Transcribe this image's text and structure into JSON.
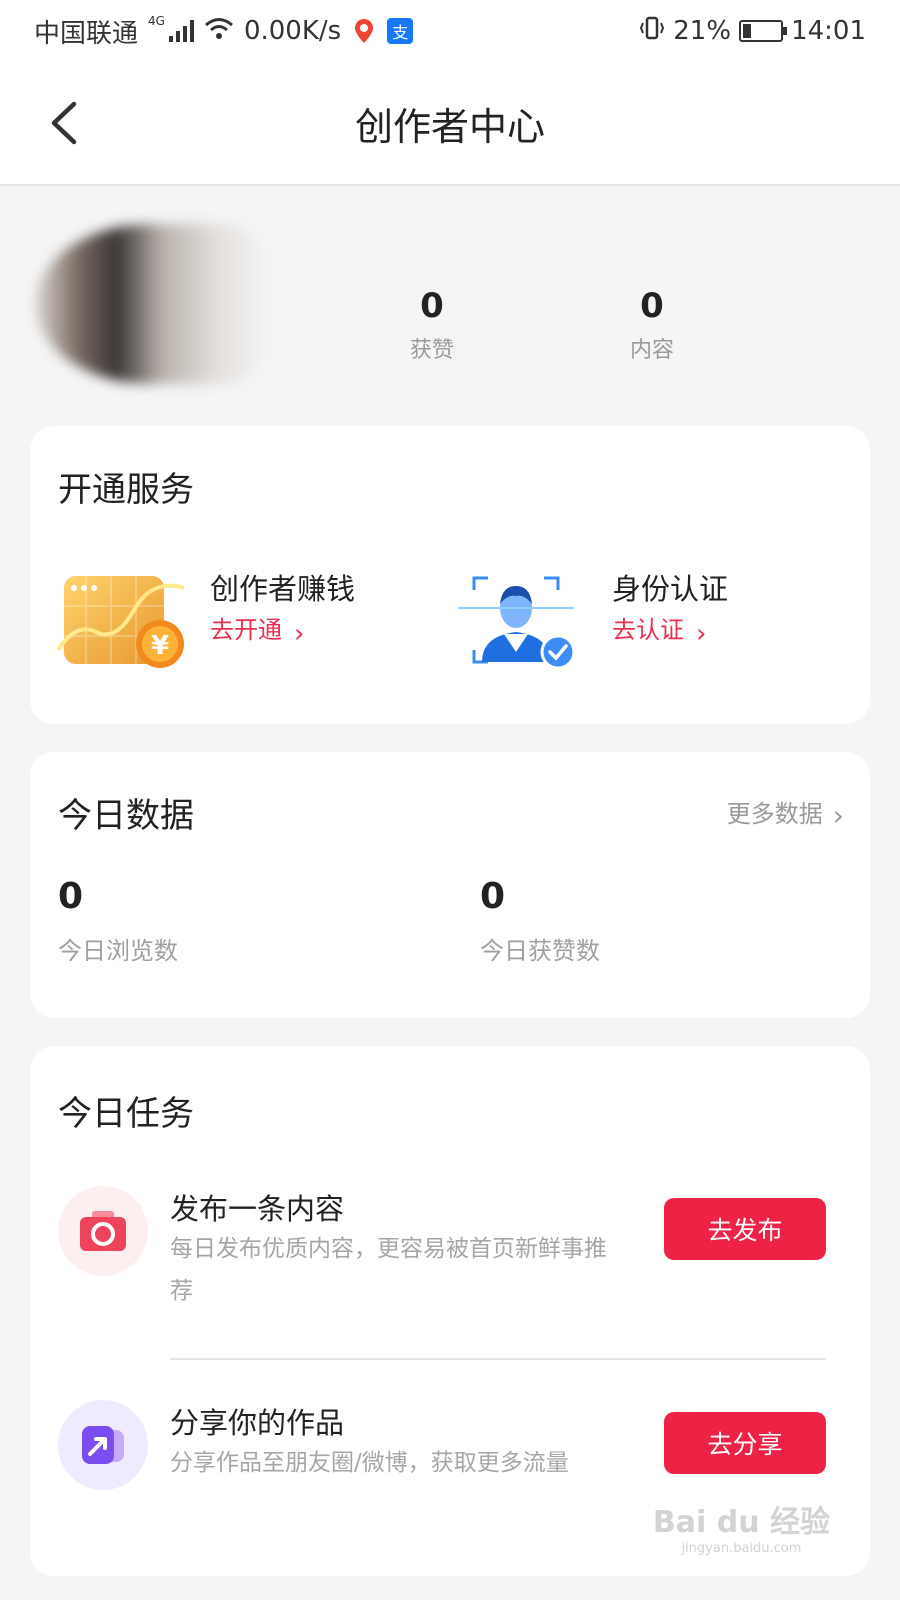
{
  "status_bar": {
    "carrier": "中国联通",
    "network": "4G",
    "speed": "0.00K/s",
    "battery": "21%",
    "battery_level": 0.21,
    "time": "14:01",
    "app_icons": [
      "baidu-map-icon",
      "alipay-icon"
    ]
  },
  "nav": {
    "title": "创作者中心",
    "back_icon": "chevron-left-icon"
  },
  "profile": {
    "stats": [
      {
        "value": "0",
        "label": "获赞"
      },
      {
        "value": "0",
        "label": "内容"
      }
    ]
  },
  "services": {
    "title": "开通服务",
    "items": [
      {
        "name": "创作者赚钱",
        "action": "去开通",
        "icon": "earnings-chart-icon"
      },
      {
        "name": "身份认证",
        "action": "去认证",
        "icon": "identity-verify-icon"
      }
    ]
  },
  "today_data": {
    "title": "今日数据",
    "more_label": "更多数据",
    "stats": [
      {
        "value": "0",
        "label": "今日浏览数"
      },
      {
        "value": "0",
        "label": "今日获赞数"
      }
    ]
  },
  "today_tasks": {
    "title": "今日任务",
    "tasks": [
      {
        "title": "发布一条内容",
        "desc": "每日发布优质内容，更容易被首页新鲜事推荐",
        "button": "去发布",
        "icon": "camera-icon"
      },
      {
        "title": "分享你的作品",
        "desc": "分享作品至朋友圈/微博，获取更多流量",
        "button": "去分享",
        "icon": "share-icon"
      }
    ]
  },
  "watermark": {
    "brand": "Bai du 经验",
    "url": "jingyan.baidu.com"
  },
  "colors": {
    "accent": "#ee2244",
    "link_red": "#e8304f",
    "background": "#f5f5f5",
    "card": "#ffffff",
    "muted_text": "#999999"
  }
}
